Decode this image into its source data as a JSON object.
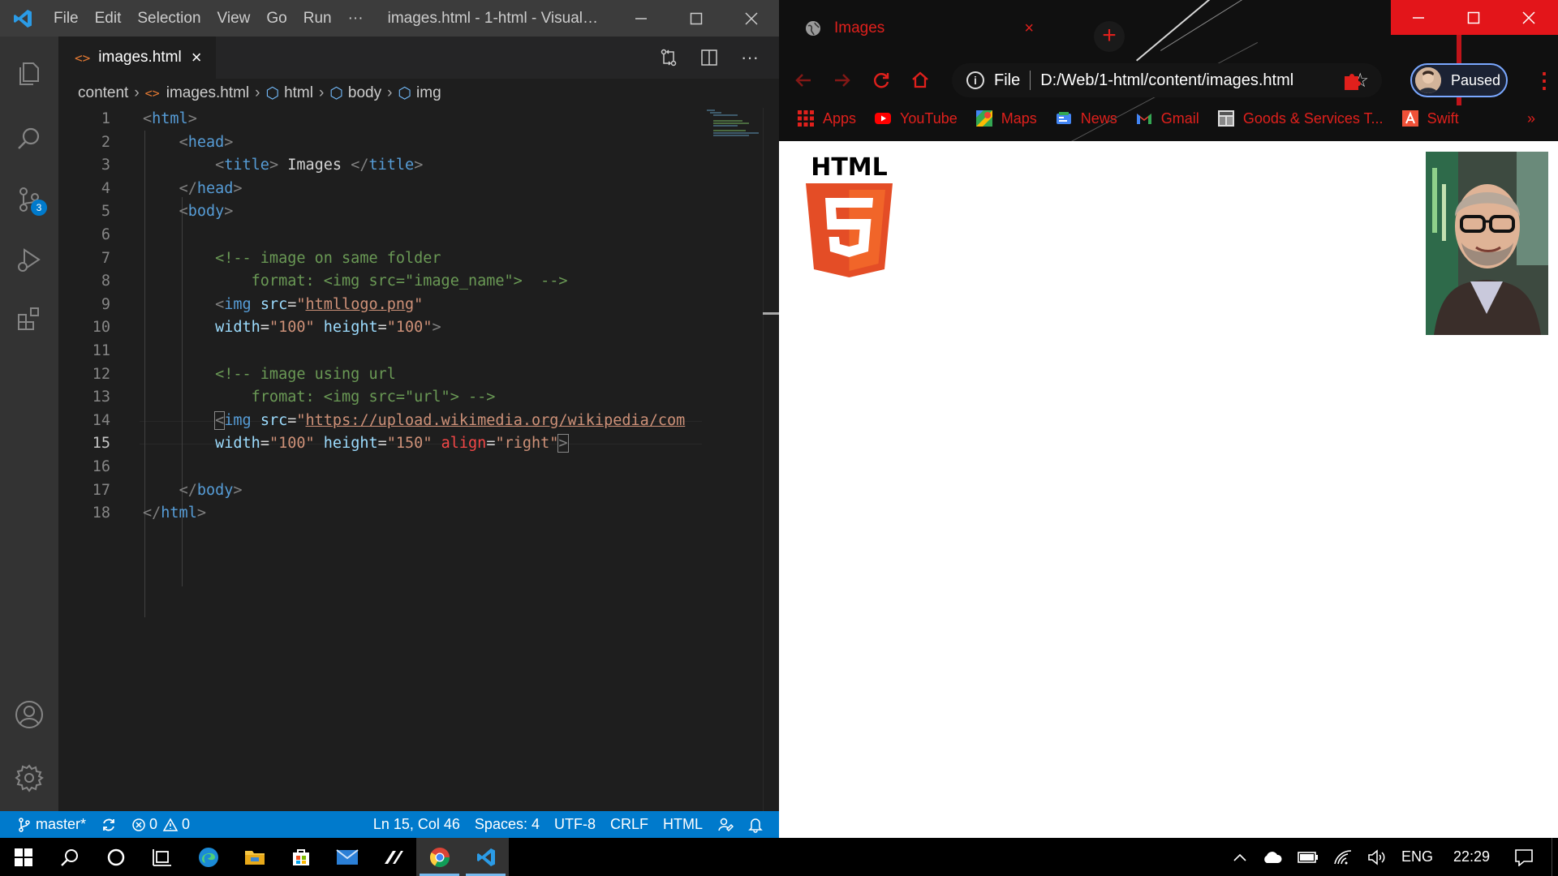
{
  "vscode": {
    "menu": [
      "File",
      "Edit",
      "Selection",
      "View",
      "Go",
      "Run",
      "···"
    ],
    "window_title": "images.html - 1-html - Visual ...",
    "activity_badge": "3",
    "tab": {
      "icon": "<>",
      "label": "images.html",
      "close": "×"
    },
    "breadcrumb": [
      "content",
      "images.html",
      "html",
      "body",
      "img"
    ],
    "code_lines": [
      {
        "n": "1"
      },
      {
        "n": "2"
      },
      {
        "n": "3"
      },
      {
        "n": "4"
      },
      {
        "n": "5"
      },
      {
        "n": "6"
      },
      {
        "n": "7"
      },
      {
        "n": "8"
      },
      {
        "n": "9"
      },
      {
        "n": "10"
      },
      {
        "n": "11"
      },
      {
        "n": "12"
      },
      {
        "n": "13"
      },
      {
        "n": "14"
      },
      {
        "n": "15"
      },
      {
        "n": "16"
      },
      {
        "n": "17"
      },
      {
        "n": "18"
      }
    ],
    "code": {
      "l1_tag": "html",
      "l2_tag": "head",
      "l3_tag_open": "title",
      "l3_text": " Images ",
      "l3_tag_close": "title",
      "l4_tag": "head",
      "l5_tag": "body",
      "l7_comment": "<!-- image on same folder",
      "l8_comment": "    format: <img src=\"image_name\">  -->",
      "l9_tag": "img",
      "l9_attr": "src",
      "l9_val": "htmllogo.png",
      "l10_attr1": "width",
      "l10_val1": "\"100\"",
      "l10_attr2": "height",
      "l10_val2": "\"100\"",
      "l12_comment": "<!-- image using url",
      "l13_comment": "    fromat: <img src=\"url\"> -->",
      "l14_tag": "img",
      "l14_attr": "src",
      "l14_val": "https://upload.wikimedia.org/wikipedia/com",
      "l15_attr1": "width",
      "l15_val1": "\"100\"",
      "l15_attr2": "height",
      "l15_val2": "\"150\"",
      "l15_attr3": "align",
      "l15_val3": "\"right\"",
      "l17_tag": "body",
      "l18_tag": "html"
    },
    "current_line": "15",
    "status": {
      "branch": "master*",
      "errors": "0",
      "warnings": "0",
      "cursor": "Ln 15, Col 46",
      "spaces": "Spaces: 4",
      "encoding": "UTF-8",
      "eol": "CRLF",
      "language": "HTML"
    },
    "colors": {
      "titlebar": "#3c3c3c",
      "activitybar": "#333333",
      "editor": "#1e1e1e",
      "statusbar": "#007acc"
    }
  },
  "chrome": {
    "tab_title": "Images",
    "tab_close": "×",
    "new_tab": "+",
    "url_scheme": "File",
    "url": "D:/Web/1-html/content/images.html",
    "profile_status": "Paused",
    "bookmarks": [
      {
        "label": "Apps",
        "icon": "apps-grid-icon"
      },
      {
        "label": "YouTube",
        "icon": "youtube-icon"
      },
      {
        "label": "Maps",
        "icon": "maps-icon"
      },
      {
        "label": "News",
        "icon": "news-icon"
      },
      {
        "label": "Gmail",
        "icon": "gmail-icon"
      },
      {
        "label": "Goods & Services T...",
        "icon": "goods-services-icon"
      },
      {
        "label": "Swift",
        "icon": "swift-icon"
      }
    ],
    "bookmarks_overflow": "»",
    "page": {
      "logo_text": "HTML",
      "logo_number": "5"
    },
    "colors": {
      "accent": "#e0201c",
      "frame": "#101010",
      "html5_orange": "#e44d26",
      "html5_light": "#f16529"
    }
  },
  "taskbar": {
    "language": "ENG",
    "time": "22:29"
  }
}
